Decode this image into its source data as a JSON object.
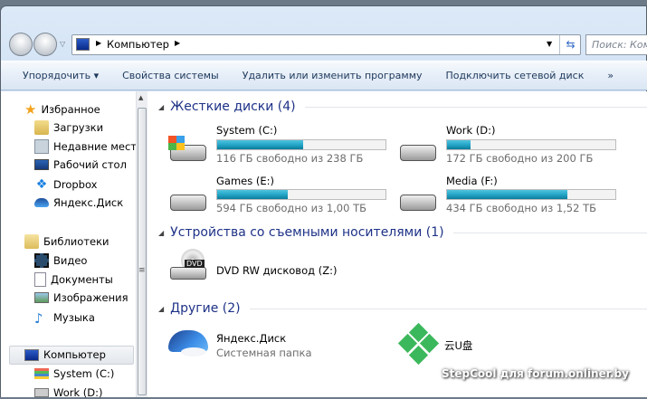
{
  "nav": {
    "breadcrumb": "Компьютер",
    "search_placeholder": "Поиск: Компьютер"
  },
  "toolbar": {
    "organize": "Упорядочить ▾",
    "system_props": "Свойства системы",
    "uninstall": "Удалить или изменить программу",
    "map_drive": "Подключить сетевой диск",
    "more": "»"
  },
  "sidebar": {
    "favorites": "Избранное",
    "fav_items": [
      "Загрузки",
      "Недавние места",
      "Рабочий стол",
      "Dropbox",
      "Яндекс.Диск"
    ],
    "libraries": "Библиотеки",
    "lib_items": [
      "Видео",
      "Документы",
      "Изображения",
      "Музыка"
    ],
    "computer": "Компьютер",
    "comp_items": [
      "System (C:)",
      "Work (D:)"
    ]
  },
  "sections": {
    "hdd": "Жесткие диски (4)",
    "removable": "Устройства со съемными носителями (1)",
    "other": "Другие (2)"
  },
  "drives": [
    {
      "name": "System (C:)",
      "free": "116 ГБ свободно из 238 ГБ",
      "used_fraction": 0.513
    },
    {
      "name": "Work (D:)",
      "free": "172 ГБ свободно из 200 ГБ",
      "used_fraction": 0.14
    },
    {
      "name": "Games (E:)",
      "free": "594 ГБ свободно из 1,00 ТБ",
      "used_fraction": 0.42
    },
    {
      "name": "Media (F:)",
      "free": "434 ГБ свободно из 1,52 ТБ",
      "used_fraction": 0.714
    }
  ],
  "removable": [
    {
      "name": "DVD RW дисковод (Z:)",
      "badge": "DVD"
    }
  ],
  "other": [
    {
      "name": "Яндекс.Диск",
      "sub": "Системная папка"
    },
    {
      "name": "云U盘"
    }
  ],
  "watermark": "StepCool для forum.onliner.by"
}
